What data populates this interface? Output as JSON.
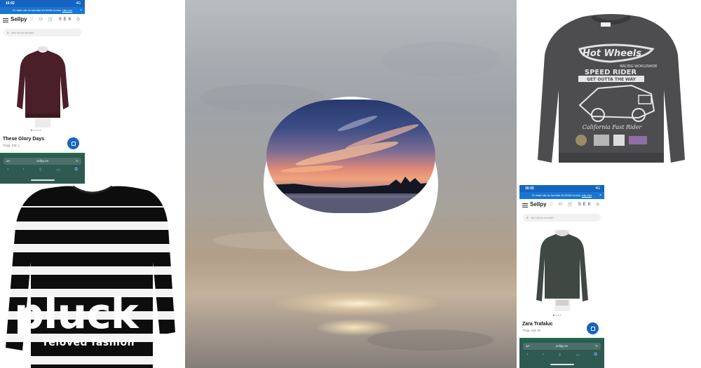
{
  "phone_top_left": {
    "status_time": "16:02",
    "status_signal": "4G",
    "banner_text": "Fri frakt när du handlar för 500kr kronor",
    "banner_link": "Läs mer",
    "banner_close": "×",
    "logo": "Sellpy",
    "nav_icons": "♡ ⚇ 🛒 SEK ◇",
    "search_placeholder": "Vad vill du handla?",
    "product_title": "These Glory Days",
    "product_sub": "Tröja, Strl: L",
    "address_aa": "aA",
    "address_url": "sellpy.se",
    "toolbar_icons": [
      "‹",
      "›",
      "⇪",
      "▭",
      "⧉"
    ]
  },
  "phone_bottom_right": {
    "status_time": "16:02",
    "status_signal": "4G",
    "banner_text": "Fri frakt när du handlar för 500kr kronor",
    "banner_link": "Läs mer",
    "banner_close": "×",
    "logo": "Sellpy",
    "nav_icons": "♡ ⚇ 🛒 SEK ◇",
    "search_placeholder": "Vad vill du handla?",
    "product_title": "Zara Trafaluc",
    "product_sub": "Tröja, Strl: M",
    "address_aa": "aA",
    "address_url": "sellpy.se",
    "toolbar_icons": [
      "‹",
      "›",
      "⇪",
      "▭",
      "⧉"
    ]
  },
  "pluck": {
    "logo_word": "pluck",
    "tagline": "reloved fashion"
  },
  "sweatshirt_print": {
    "brand_script": "Hot Wheels",
    "line1": "RACING WORLDWIDE",
    "line2": "SPEED RIDER",
    "line3": "GET OUTTA THE WAY",
    "script2": "California Fast Rider"
  },
  "colors": {
    "sellpy_blue": "#1565c0",
    "safari_bar": "#2f5a52",
    "sweatshirt": "#4d4d4f",
    "burgundy_sweater": "#4a1f2a"
  }
}
